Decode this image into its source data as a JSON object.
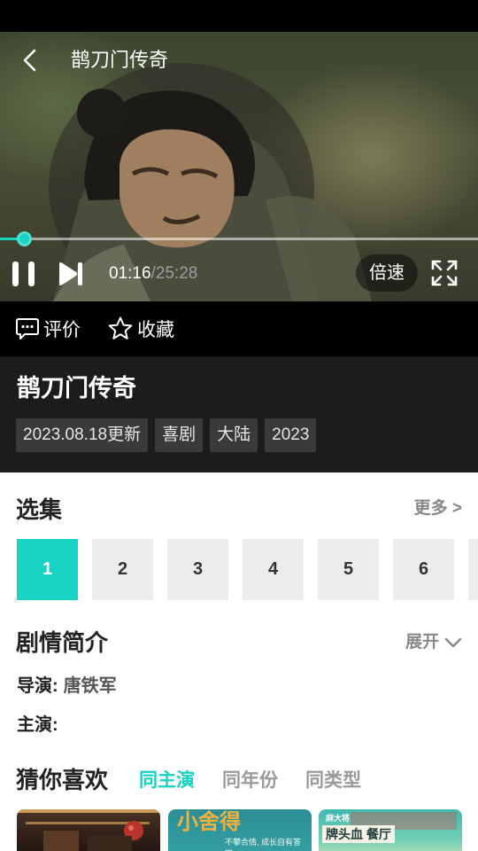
{
  "player": {
    "title": "鹊刀门传奇",
    "current_time": "01:16",
    "separator": "/",
    "duration": "25:28",
    "progress": 0.05,
    "speed_label": "倍速",
    "accent": "#17d3c2"
  },
  "actions": {
    "comment_label": "评价",
    "favorite_label": "收藏"
  },
  "info": {
    "title": "鹊刀门传奇",
    "tags": [
      "2023.08.18更新",
      "喜剧",
      "大陆",
      "2023"
    ]
  },
  "episodes": {
    "title": "选集",
    "more_label": "更多 >",
    "items": [
      "1",
      "2",
      "3",
      "4",
      "5",
      "6"
    ],
    "selected": "1"
  },
  "synopsis": {
    "title": "剧情简介",
    "expand_label": "展开",
    "director_label": "导演:",
    "director_value": "唐铁军",
    "cast_label": "主演:",
    "cast_value": ""
  },
  "recommend": {
    "title": "猜你喜欢",
    "tabs": [
      "同主演",
      "同年份",
      "同类型"
    ],
    "active_tab": "同主演",
    "card2_text": "小舍得",
    "card2_sub": "不攀合情, 成长自有答案。",
    "card3_text": "牌头血 餐厅",
    "card3_top": "麻大将"
  },
  "icons": {
    "back": "chevron-left-icon",
    "pause": "pause-icon",
    "next": "skip-next-icon",
    "fullscreen": "fullscreen-icon",
    "comment": "comment-bubble-icon",
    "favorite": "star-outline-icon",
    "expand": "chevron-down-icon"
  }
}
